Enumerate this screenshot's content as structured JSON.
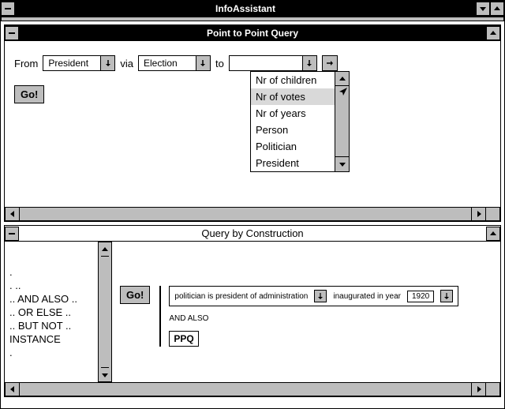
{
  "app": {
    "title": "InfoAssistant"
  },
  "ptp": {
    "title": "Point to Point Query",
    "from_label": "From",
    "from_value": "President",
    "via_label": "via",
    "via_value": "Election",
    "to_label": "to",
    "to_value": "",
    "go_label": "Go!",
    "dropdown": {
      "items": [
        "Nr of children",
        "Nr of votes",
        "Nr of years",
        "Person",
        "Politician",
        "President"
      ],
      "highlight_index": 1
    }
  },
  "qbc": {
    "title": "Query by Construction",
    "go_label": "Go!",
    "terms": [
      ".",
      ". ..",
      ".. AND ALSO ..",
      ".. OR ELSE ..",
      ".. BUT NOT ..",
      "INSTANCE",
      "."
    ],
    "clause1": "politician is president of administration",
    "clause2": "inaugurated in year",
    "year": "1920",
    "connector": "AND ALSO",
    "ppq_label": "PPQ"
  }
}
